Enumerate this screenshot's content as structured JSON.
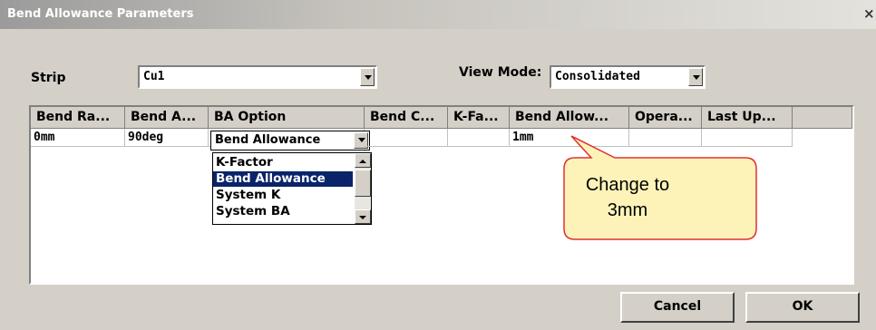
{
  "window": {
    "title": "Bend Allowance Parameters",
    "close_glyph": "×"
  },
  "strip": {
    "label": "Strip",
    "value": "Cu1"
  },
  "view_mode": {
    "label": "View Mode:",
    "value": "Consolidated"
  },
  "grid": {
    "columns": [
      "Bend Ra...",
      "Bend A...",
      "BA Option",
      "Bend C...",
      "K-Fa...",
      "Bend Allow...",
      "Opera...",
      "Last Up..."
    ],
    "row": {
      "bend_radius": "0mm",
      "bend_angle": "90deg",
      "ba_option": "Bend Allowance",
      "bend_c": "",
      "k_factor": "",
      "bend_allowance": "1mm",
      "operator": "",
      "last_updated": ""
    }
  },
  "ba_option_list": {
    "options": [
      "K-Factor",
      "Bend Allowance",
      "System K",
      "System BA"
    ],
    "selected": "Bend Allowance"
  },
  "callout": {
    "line1": "Change to",
    "line2": "3mm",
    "fill_color": "#fdf3b8",
    "stroke_color": "#e03030"
  },
  "buttons": {
    "cancel": "Cancel",
    "ok": "OK"
  },
  "colors": {
    "dialog_bg": "#d4d0c8",
    "selection": "#0a246a"
  }
}
